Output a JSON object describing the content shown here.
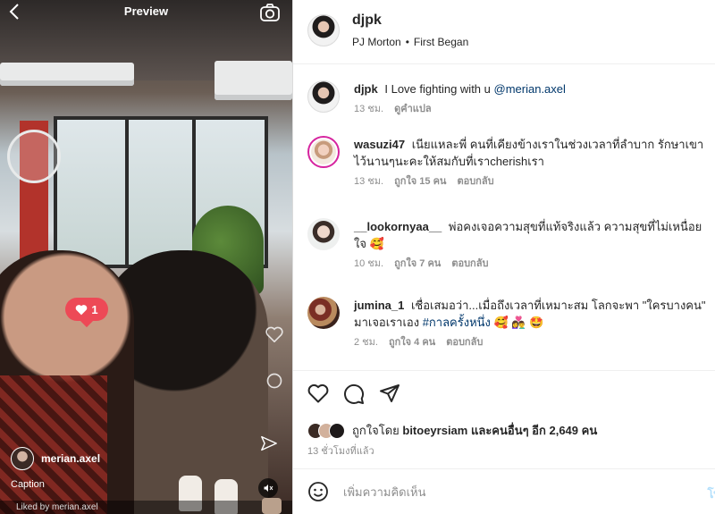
{
  "media": {
    "title": "Preview",
    "like_count": "1",
    "overlay_username": "merian.axel",
    "caption": "Caption",
    "liked_by": "Liked by merian.axel"
  },
  "header": {
    "username": "djpk",
    "music_artist": "PJ Morton",
    "music_separator": "•",
    "music_song": "First Began"
  },
  "comments": [
    {
      "username": "djpk",
      "text": "I Love fighting with u",
      "mention": "@merian.axel",
      "time": "13 ชม.",
      "translate": "ดูคำแปล"
    },
    {
      "username": "wasuzi47",
      "text": "เนียแหละพี่ คนที่เคียงข้างเราในช่วงเวลาที่ลำบาก รักษาเขาไว้นานๆนะคะให้สมกับที่เราcherishเรา",
      "time": "13 ชม.",
      "likes": "ถูกใจ 15 คน",
      "reply": "ตอบกลับ"
    },
    {
      "username": "__lookornyaa__",
      "text": "พ่อคงเจอความสุขที่แท้จริงแล้ว ความสุขที่ไม่เหนื่อยใจ",
      "emoji": "🥰",
      "time": "10 ชม.",
      "likes": "ถูกใจ 7 คน",
      "reply": "ตอบกลับ"
    },
    {
      "username": "jumina_1",
      "text": "เชื่อเสมอว่า...เมื่อถึงเวลาที่เหมาะสม โลกจะพา \"ใครบางคน\" มาเจอเราเอง",
      "hashtag": "#กาลครั้งหนึ่ง",
      "emoji": "🥰 👩‍❤️‍👨 🤩",
      "time": "2 ชม.",
      "likes": "ถูกใจ 4 คน",
      "reply": "ตอบกลับ"
    }
  ],
  "likes": {
    "prefix": "ถูกใจโดย",
    "liker": "bitoeyrsiam",
    "and_others": "และคนอื่นๆ อีก 2,649 คน"
  },
  "post_time": "13 ชั่วโมงที่แล้ว",
  "add_comment": {
    "placeholder": "เพิ่มความคิดเห็น",
    "post_label": "โพ"
  },
  "colors": {
    "like_red": "#ed4956",
    "link_blue": "#00376b",
    "post_disabled": "#b2dffc",
    "meta_gray": "#8e8e8e"
  },
  "icons": [
    "back-icon",
    "camera-icon",
    "heart-icon",
    "comment-icon",
    "send-icon",
    "emoji-icon",
    "mute-icon"
  ]
}
